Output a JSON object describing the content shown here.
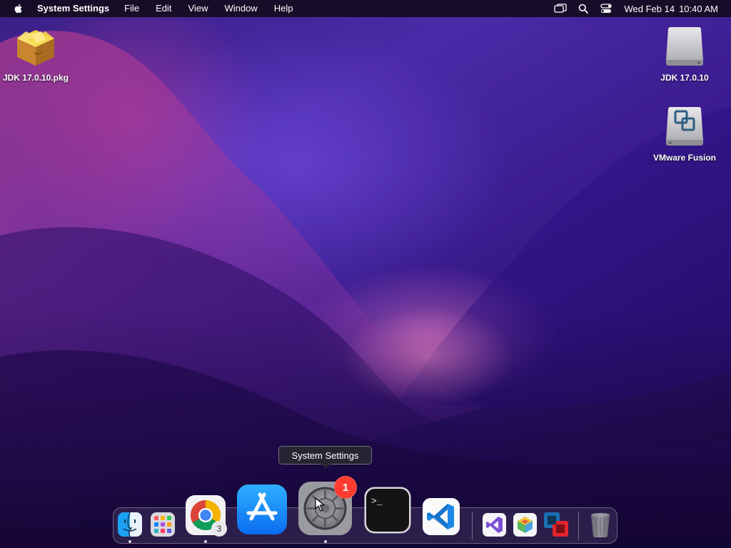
{
  "menubar": {
    "app_name": "System Settings",
    "items": [
      "File",
      "Edit",
      "View",
      "Window",
      "Help"
    ],
    "date": "Wed Feb 14",
    "time": "10:40 AM",
    "icons": [
      "screen-mirroring-icon",
      "spotlight-search-icon",
      "control-center-icon"
    ]
  },
  "desktop": {
    "icons": [
      {
        "name": "jdk-pkg",
        "label": "JDK 17.0.10.pkg",
        "icon": "package-icon"
      },
      {
        "name": "jdk-volume",
        "label": "JDK 17.0.10",
        "icon": "disk-volume-icon"
      },
      {
        "name": "vmware-volume",
        "label": "VMware Fusion",
        "icon": "vmware-disk-icon"
      }
    ]
  },
  "tooltip": {
    "text": "System Settings"
  },
  "dock": {
    "apps": [
      {
        "name": "Finder",
        "icon": "finder-icon",
        "running": true
      },
      {
        "name": "Launchpad",
        "icon": "launchpad-icon",
        "running": false
      },
      {
        "name": "Google Chrome",
        "icon": "chrome-icon",
        "running": true,
        "badge": "3"
      },
      {
        "name": "App Store",
        "icon": "app-store-icon",
        "running": false
      },
      {
        "name": "System Settings",
        "icon": "system-settings-icon",
        "running": true,
        "badge": "1"
      },
      {
        "name": "Terminal",
        "icon": "terminal-icon",
        "running": false
      },
      {
        "name": "Visual Studio Code",
        "icon": "vscode-icon",
        "running": false
      },
      {
        "name": "Visual Studio",
        "icon": "visual-studio-icon",
        "running": false
      },
      {
        "name": "Package Maker",
        "icon": "package-cube-icon",
        "running": false
      },
      {
        "name": "VMware Fusion",
        "icon": "vmware-fusion-icon",
        "running": false
      },
      {
        "name": "Trash",
        "icon": "trash-icon",
        "running": false
      }
    ]
  },
  "colors": {
    "badge_red": "#ff3b30",
    "app_store_blue": "#1a8cff",
    "vscode_blue": "#1e88e5"
  }
}
